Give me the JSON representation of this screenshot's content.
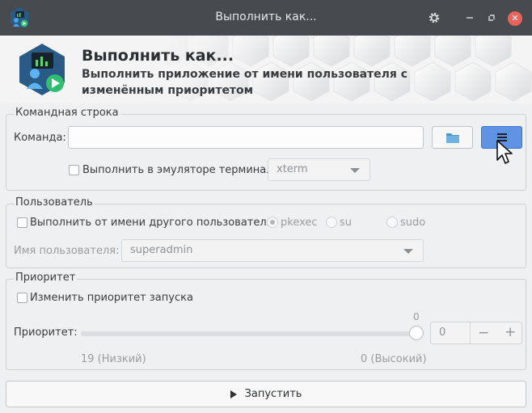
{
  "window": {
    "title": "Выполнить как..."
  },
  "header": {
    "title": "Выполнить как...",
    "subtitle": "Выполнить приложение от имени пользователя с изменённым приоритетом"
  },
  "command_group": {
    "title": "Командная строка",
    "command_label": "Команда:",
    "command_value": "",
    "terminal_checkbox_label": "Выполнить в эмуляторе терминала",
    "terminal_checked": false,
    "terminal_selected": "xterm"
  },
  "user_group": {
    "title": "Пользователь",
    "other_user_label": "Выполнить от имени другого пользователя:",
    "other_user_checked": false,
    "methods": [
      "pkexec",
      "su",
      "sudo"
    ],
    "selected_method": "pkexec",
    "username_label": "Имя пользователя:",
    "username_selected": "superadmin"
  },
  "priority_group": {
    "title": "Приоритет",
    "change_label": "Изменить приоритет запуска",
    "change_checked": false,
    "priority_label": "Приоритет:",
    "slider_value_label": "0",
    "spin_value": "0",
    "spin_minus": "−",
    "spin_plus": "+",
    "low_label": "19 (Низкий)",
    "high_label": "0 (Высокий)"
  },
  "run_button": {
    "label": "Запустить"
  },
  "colors": {
    "titlebar": "#474b50",
    "accent": "#5f93e3",
    "close": "#e8635b"
  },
  "icons": [
    "app-icon",
    "gear-icon",
    "minimize-icon",
    "restore-icon",
    "close-icon",
    "folder-icon",
    "menu-icon",
    "play-icon",
    "cursor-icon"
  ]
}
